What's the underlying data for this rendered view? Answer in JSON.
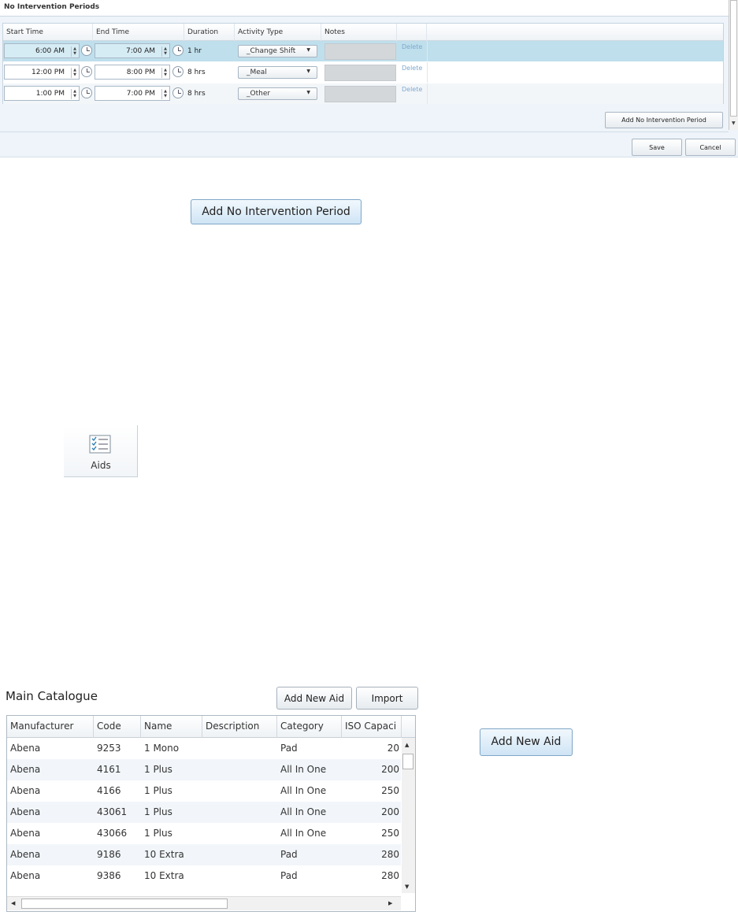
{
  "nip_panel": {
    "title": "No Intervention Periods",
    "columns": [
      "Start Time",
      "End Time",
      "Duration",
      "Activity Type",
      "Notes"
    ],
    "rows": [
      {
        "start": "6:00 AM",
        "end": "7:00 AM",
        "duration": "1 hr",
        "activity": "_Change Shift",
        "delete": "Delete"
      },
      {
        "start": "12:00 PM",
        "end": "8:00 PM",
        "duration": "8 hrs",
        "activity": "_Meal",
        "delete": "Delete"
      },
      {
        "start": "1:00 PM",
        "end": "7:00 PM",
        "duration": "8 hrs",
        "activity": "_Other",
        "delete": "Delete"
      }
    ],
    "add_button": "Add No Intervention Period",
    "save": "Save",
    "cancel": "Cancel"
  },
  "standalone_nip_button": "Add No Intervention Period",
  "aids_tile": {
    "label": "Aids",
    "icon": "checklist-icon"
  },
  "catalogue": {
    "title": "Main Catalogue",
    "add_button": "Add New Aid",
    "import_button": "Import",
    "columns": [
      "Manufacturer",
      "Code",
      "Name",
      "Description",
      "Category",
      "ISO Capaci"
    ],
    "rows": [
      {
        "manufacturer": "Abena",
        "code": "9253",
        "name": "1 Mono",
        "description": "",
        "category": "Pad",
        "iso": "20"
      },
      {
        "manufacturer": "Abena",
        "code": "4161",
        "name": "1 Plus",
        "description": "",
        "category": "All In One",
        "iso": "200"
      },
      {
        "manufacturer": "Abena",
        "code": "4166",
        "name": "1 Plus",
        "description": "",
        "category": "All In One",
        "iso": "250"
      },
      {
        "manufacturer": "Abena",
        "code": "43061",
        "name": "1 Plus",
        "description": "",
        "category": "All In One",
        "iso": "200"
      },
      {
        "manufacturer": "Abena",
        "code": "43066",
        "name": "1 Plus",
        "description": "",
        "category": "All In One",
        "iso": "250"
      },
      {
        "manufacturer": "Abena",
        "code": "9186",
        "name": "10 Extra",
        "description": "",
        "category": "Pad",
        "iso": "280"
      },
      {
        "manufacturer": "Abena",
        "code": "9386",
        "name": "10 Extra",
        "description": "",
        "category": "Pad",
        "iso": "280"
      }
    ]
  },
  "standalone_add_aid_button": "Add New Aid",
  "colors": {
    "selected_row": "#bfdfec",
    "link": "#7ea8cf",
    "button_blue_top": "#f1f8fd",
    "button_blue_bottom": "#cfe4f5"
  }
}
